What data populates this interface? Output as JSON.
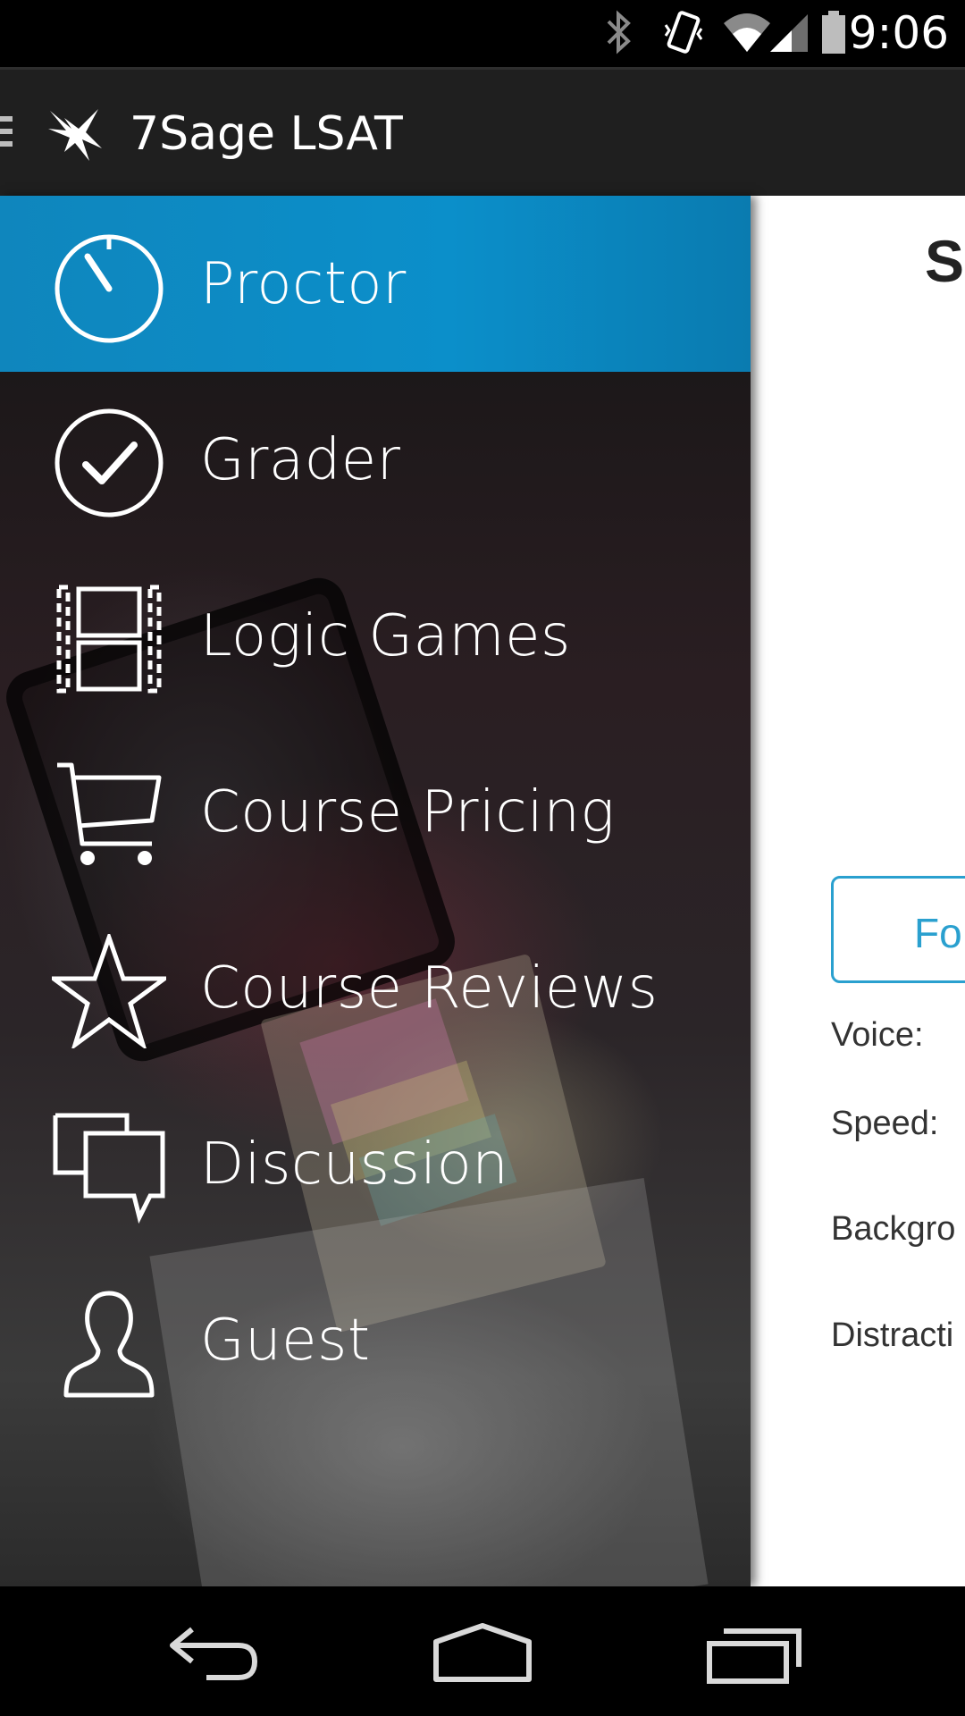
{
  "status_bar": {
    "time": "9:06",
    "icons": [
      "bluetooth-icon",
      "vibrate-icon",
      "wifi-icon",
      "cell-signal-icon",
      "battery-icon"
    ]
  },
  "app_bar": {
    "title": "7Sage LSAT",
    "logo": "7sage-bird-logo",
    "menu_icon": "hamburger-icon"
  },
  "drawer": {
    "accent_color": "#0b8fca",
    "items": [
      {
        "label": "Proctor",
        "icon": "stopwatch-icon",
        "active": true
      },
      {
        "label": "Grader",
        "icon": "check-circle-icon",
        "active": false
      },
      {
        "label": "Logic Games",
        "icon": "film-strip-icon",
        "active": false
      },
      {
        "label": "Course Pricing",
        "icon": "cart-icon",
        "active": false
      },
      {
        "label": "Course Reviews",
        "icon": "star-icon",
        "active": false
      },
      {
        "label": "Discussion",
        "icon": "chat-bubbles-icon",
        "active": false
      },
      {
        "label": "Guest",
        "icon": "user-icon",
        "active": false
      }
    ]
  },
  "content": {
    "heading": "Se",
    "button_label": "Fo",
    "labels": {
      "voice": "Voice:",
      "speed": "Speed:",
      "background": "Backgro",
      "distraction": "Distracti"
    }
  },
  "nav_bar": {
    "back": "back-icon",
    "home": "home-icon",
    "recents": "recents-icon"
  }
}
